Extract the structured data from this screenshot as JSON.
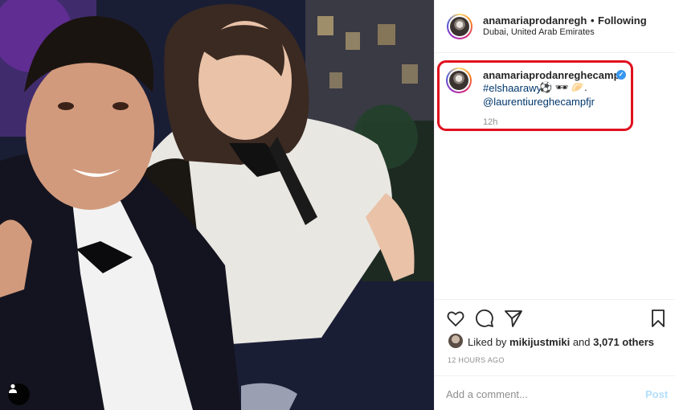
{
  "post": {
    "username": "anamariaprodanreghec",
    "follow_separator": "•",
    "follow_label": "Following",
    "location": "Dubai, United Arab Emirates",
    "more_icon": "more-horizontal-icon"
  },
  "caption": {
    "username": "anamariaprodanreghecampf",
    "verified": true,
    "hashtag": "#elshaarawy",
    "emojis": "⚽ 🕶 🥟.",
    "mention": "@laurentiureghecampfjr",
    "time": "12h"
  },
  "actions": {
    "icons": [
      "heart-icon",
      "comment-icon",
      "share-icon",
      "bookmark-icon"
    ],
    "liked_by_prefix": "Liked by",
    "liked_by_user": "mikijustmiki",
    "and": "and",
    "others": "3,071 others",
    "posted_ago": "12 HOURS AGO"
  },
  "comment_box": {
    "placeholder": "Add a comment...",
    "post_label": "Post"
  },
  "colors": {
    "highlight": "#e0101f",
    "link": "#00376b",
    "verified": "#3897f0",
    "post_disabled": "#b2dffc"
  }
}
